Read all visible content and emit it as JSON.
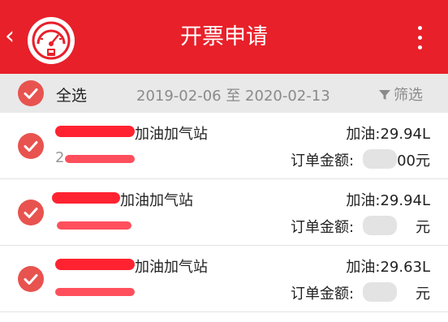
{
  "header": {
    "back_glyph": "‹",
    "title": "开票申请",
    "logo_icon": "fuel-gauge-icon",
    "more_icon": "more-vertical-icon"
  },
  "filterbar": {
    "select_all_label": "全选",
    "date_range": "2019-02-06 至 2020-02-13",
    "filter_label": "筛选",
    "filter_icon": "funnel-icon"
  },
  "orders": [
    {
      "station": "加油加气站",
      "fuel": "加油:29.94L",
      "amount_label": "订单金额:",
      "amount_suffix": "00元",
      "partial_no": "2"
    },
    {
      "station": "加油加气站",
      "fuel": "加油:29.94L",
      "amount_label": "订单金额:",
      "amount_suffix": "元",
      "partial_no": ""
    },
    {
      "station": "加油加气站",
      "fuel": "加油:29.63L",
      "amount_label": "订单金额:",
      "amount_suffix": "元",
      "partial_no": ""
    }
  ],
  "colors": {
    "brand_red": "#e8202a",
    "check_red": "#e8534f",
    "filter_bar_bg": "#e9e9e9"
  }
}
